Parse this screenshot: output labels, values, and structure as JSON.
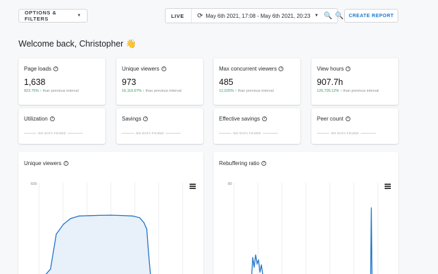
{
  "toolbar": {
    "options_label": "OPTIONS & FILTERS",
    "live_label": "LIVE",
    "date_range": "May 6th 2021, 17:08 - May 6th 2021, 20:23",
    "create_report_label": "CREATE REPORT"
  },
  "welcome": "Welcome back, Christopher 👋",
  "stats": [
    {
      "title": "Page loads",
      "value": "1,638",
      "pct": "923.75%",
      "suffix": " than previous interval"
    },
    {
      "title": "Unique viewers",
      "value": "973",
      "pct": "16,116.67%",
      "suffix": " than previous interval"
    },
    {
      "title": "Max concurrent viewers",
      "value": "485",
      "pct": "12,025%",
      "suffix": " than previous interval"
    },
    {
      "title": "View hours",
      "value": "907.7h",
      "pct": "126,726.12%",
      "suffix": " than previous interval"
    }
  ],
  "nodata_cards": [
    {
      "title": "Utilization"
    },
    {
      "title": "Savings"
    },
    {
      "title": "Effective savings"
    },
    {
      "title": "Peer count"
    }
  ],
  "nodata_label": "NO DATA FOUND",
  "colors": {
    "accent": "#1976d2",
    "positive": "#2e9e5b",
    "series": "#1e73c8"
  },
  "chart_data": [
    {
      "type": "area",
      "title": "Unique viewers",
      "ylim": [
        0,
        600
      ],
      "yticks": [
        "600"
      ],
      "x": [
        0.0,
        0.08,
        0.12,
        0.17,
        0.22,
        0.28,
        0.35,
        0.42,
        0.5,
        0.58,
        0.65,
        0.7,
        0.73,
        0.75,
        0.76,
        0.78
      ],
      "values": [
        0,
        80,
        290,
        350,
        385,
        400,
        402,
        404,
        405,
        403,
        400,
        390,
        360,
        320,
        200,
        0
      ],
      "grid": true
    },
    {
      "type": "line",
      "title": "Rebuffering ratio",
      "ylim": [
        0,
        80
      ],
      "yticks": [
        "80"
      ],
      "x": [
        0.12,
        0.13,
        0.14,
        0.15,
        0.16,
        0.17,
        0.18,
        0.19,
        0.2,
        0.21,
        0.22,
        0.95,
        0.955,
        0.96,
        0.965,
        0.97
      ],
      "values": [
        0,
        20,
        12,
        22,
        15,
        18,
        8,
        14,
        6,
        4,
        2,
        0,
        60,
        5,
        0,
        0
      ],
      "grid": true
    }
  ]
}
